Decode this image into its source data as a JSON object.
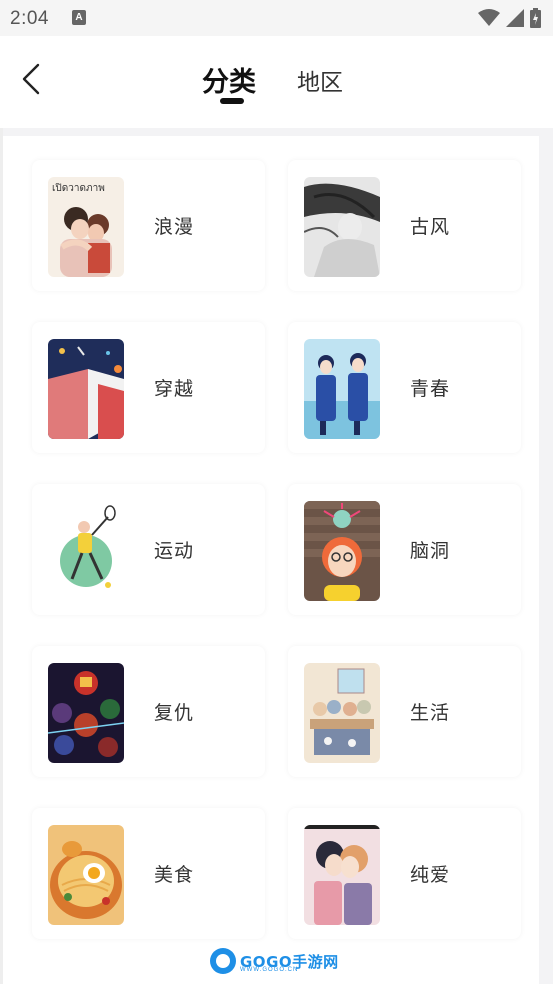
{
  "status_bar": {
    "time": "2:04",
    "notification_icon": "a-letter-icon",
    "icons": [
      "wifi-icon",
      "signal-icon",
      "battery-charging-icon"
    ]
  },
  "header": {
    "back_icon": "chevron-left-icon",
    "tabs": [
      {
        "label": "分类",
        "active": true
      },
      {
        "label": "地区",
        "active": false
      }
    ]
  },
  "categories": [
    {
      "label": "浪漫",
      "thumb_text": "เปิดวาดภาพ"
    },
    {
      "label": "古风"
    },
    {
      "label": "穿越"
    },
    {
      "label": "青春"
    },
    {
      "label": "运动"
    },
    {
      "label": "脑洞"
    },
    {
      "label": "复仇"
    },
    {
      "label": "生活"
    },
    {
      "label": "美食"
    },
    {
      "label": "纯爱"
    }
  ],
  "watermark": {
    "text": "GOGO手游网",
    "url": "WWW.GOGO.CN"
  },
  "colors": {
    "accent": "#111111",
    "background": "#ffffff",
    "watermark": "#1e8fe6"
  }
}
